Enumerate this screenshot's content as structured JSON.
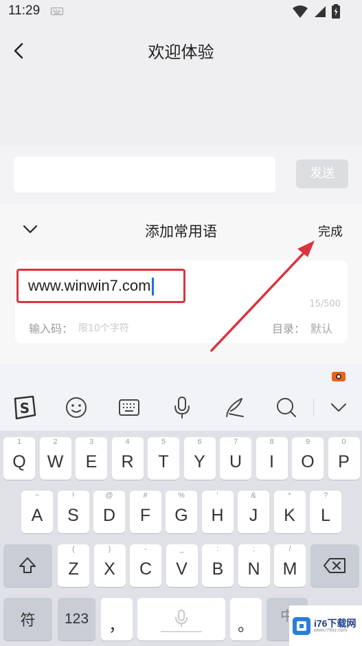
{
  "status": {
    "time": "11:29"
  },
  "header": {
    "title": "欢迎体验",
    "back_icon": "back-arrow-icon"
  },
  "composer": {
    "send_label": "发送",
    "input_value": ""
  },
  "phrase_panel": {
    "title": "添加常用语",
    "done_label": "完成",
    "entry_value": "www.winwin7.com",
    "counter": "15/500",
    "code_label": "输入码：",
    "code_placeholder": "限10个字符",
    "dir_label": "目录：",
    "dir_value": "默认",
    "highlight_color": "#d9343f",
    "annotation_arrow_color": "#d9343f"
  },
  "keyboard": {
    "toolbar_icons": [
      "sogou-logo-icon",
      "emoji-icon",
      "keyboard-icon",
      "microphone-icon",
      "handwriting-icon",
      "search-icon",
      "collapse-keyboard-icon"
    ],
    "row1": [
      {
        "label": "Q",
        "sym": "1"
      },
      {
        "label": "W",
        "sym": "2"
      },
      {
        "label": "E",
        "sym": "3"
      },
      {
        "label": "R",
        "sym": "4"
      },
      {
        "label": "T",
        "sym": "5"
      },
      {
        "label": "Y",
        "sym": "6"
      },
      {
        "label": "U",
        "sym": "7"
      },
      {
        "label": "I",
        "sym": "8"
      },
      {
        "label": "O",
        "sym": "9"
      },
      {
        "label": "P",
        "sym": "0"
      }
    ],
    "row2": [
      {
        "label": "A",
        "sym": "~"
      },
      {
        "label": "S",
        "sym": "!"
      },
      {
        "label": "D",
        "sym": "@"
      },
      {
        "label": "F",
        "sym": "#"
      },
      {
        "label": "G",
        "sym": "%"
      },
      {
        "label": "H",
        "sym": "'"
      },
      {
        "label": "J",
        "sym": "&"
      },
      {
        "label": "K",
        "sym": "*"
      },
      {
        "label": "L",
        "sym": "?"
      }
    ],
    "row3": [
      {
        "label": "Z",
        "sym": "("
      },
      {
        "label": "X",
        "sym": ")"
      },
      {
        "label": "C",
        "sym": "-"
      },
      {
        "label": "V",
        "sym": "_"
      },
      {
        "label": "B",
        "sym": ":"
      },
      {
        "label": "N",
        "sym": ";"
      },
      {
        "label": "M",
        "sym": "/"
      }
    ],
    "symbols_key": "符",
    "numbers_key": "123",
    "comma_key": "，",
    "period_key": "。",
    "lang_key": "中"
  },
  "watermark": {
    "brand": "i76下载网",
    "url": "www.i76xz.com"
  }
}
